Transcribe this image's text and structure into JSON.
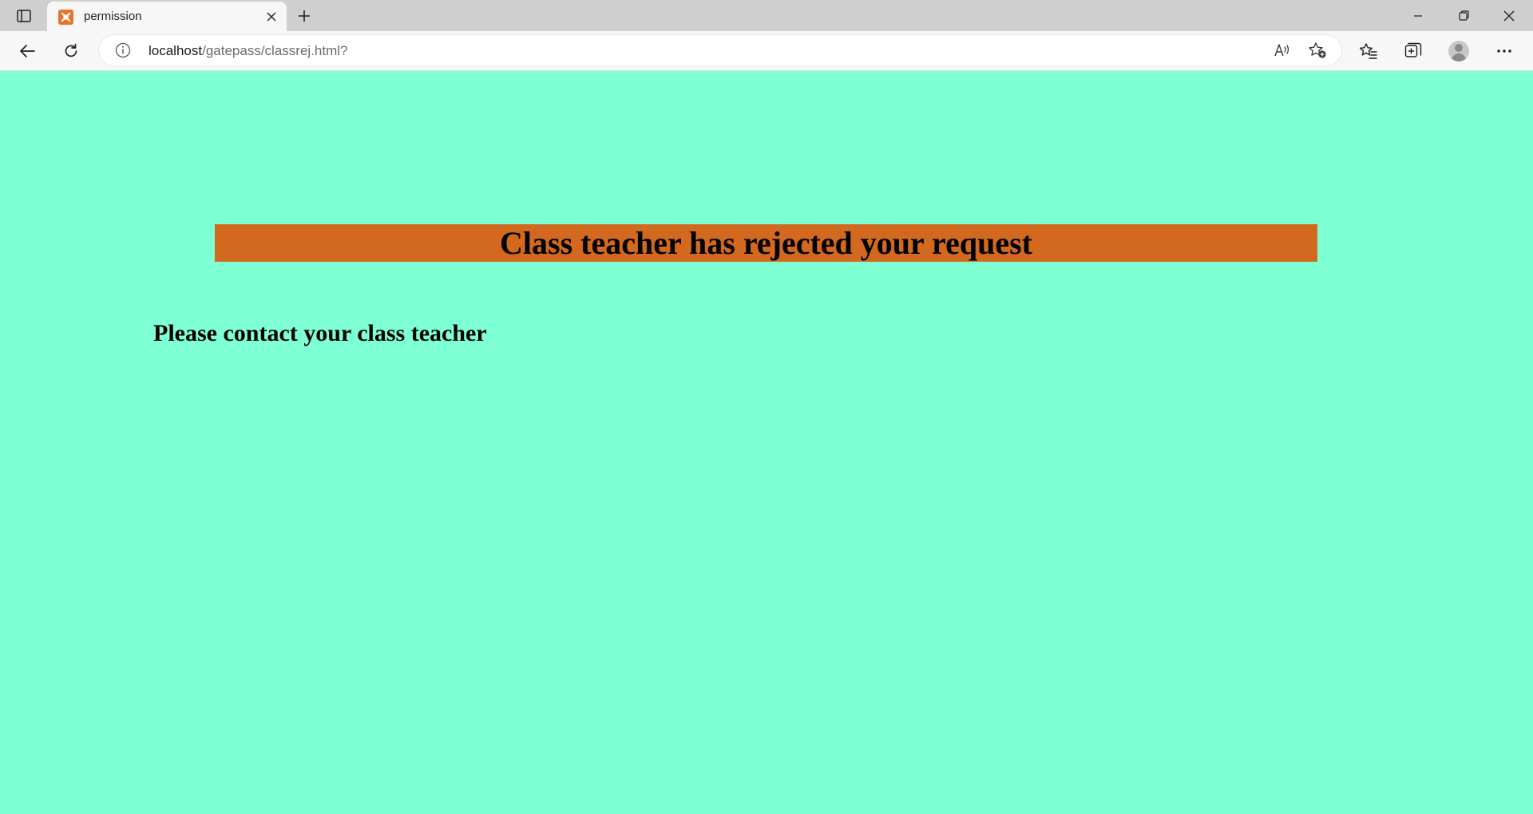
{
  "browser": {
    "tab": {
      "title": "permission",
      "favicon": "xampp-icon"
    },
    "address_bar": {
      "host": "localhost",
      "path": "/gatepass/classrej.html?"
    },
    "icons": {
      "tab_actions": "tab-actions-icon",
      "new_tab": "plus-icon",
      "back": "back-arrow-icon",
      "reload": "reload-icon",
      "site_info": "info-icon",
      "read_aloud": "read-aloud-icon",
      "add_favorite": "add-favorite-icon",
      "favorites": "favorites-icon",
      "collections": "collections-icon",
      "profile": "profile-icon",
      "more": "more-icon",
      "minimize": "minimize-icon",
      "restore": "restore-icon",
      "close": "close-icon"
    }
  },
  "page": {
    "background_color": "#7fffd4",
    "banner": {
      "text": "Class teacher has rejected your request",
      "color": "#d2691e"
    },
    "message": "Please contact your class teacher"
  }
}
